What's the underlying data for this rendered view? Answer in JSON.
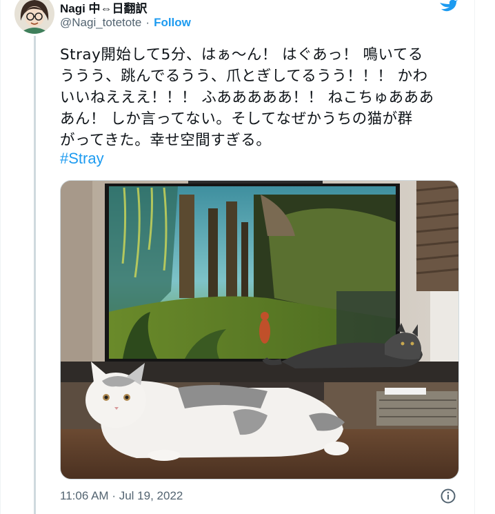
{
  "author": {
    "display_name": "Nagi 中⇔日翻訳",
    "handle": "@Nagi_totetote",
    "separator": "·",
    "follow_label": "Follow"
  },
  "tweet": {
    "lines": [
      "Stray開始して5分、はぁ～ん！ はぐあっ！ 鳴いてる",
      "ううう、跳んでるうう、爪とぎしてるうう！！！ かわ",
      "いいねえええ！！！ ふあああああ！！ ねこちゅあああ",
      "あん！ しか言ってない。そしてなぜかうちの猫が群",
      "がってきた。幸せ空間すぎる。"
    ],
    "hashtag": "#Stray"
  },
  "meta": {
    "time": "11:06 AM",
    "separator": "·",
    "date": "Jul 19, 2022"
  },
  "icons": {
    "brand": "twitter-bird-icon",
    "info": "info-icon",
    "accent": "#1d9bf0"
  }
}
